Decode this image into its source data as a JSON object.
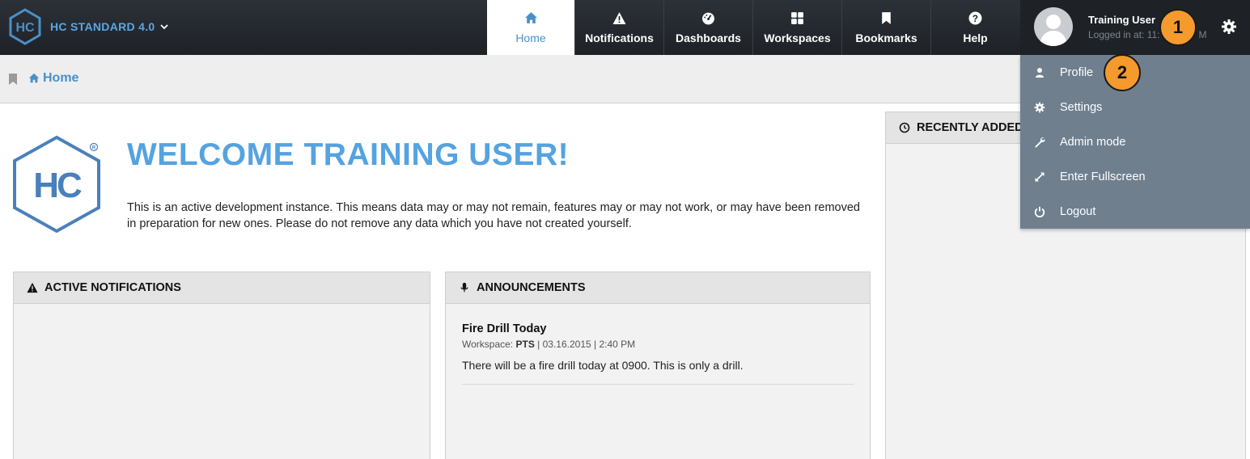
{
  "app": {
    "brand_name": "HC STANDARD 4.0"
  },
  "nav": {
    "tabs": [
      {
        "label": "Home",
        "icon": "home-icon",
        "active": true
      },
      {
        "label": "Notifications",
        "icon": "warning-icon"
      },
      {
        "label": "Dashboards",
        "icon": "dashboard-icon"
      },
      {
        "label": "Workspaces",
        "icon": "grid-icon"
      },
      {
        "label": "Bookmarks",
        "icon": "bookmark-icon"
      },
      {
        "label": "Help",
        "icon": "question-icon"
      }
    ]
  },
  "user": {
    "name": "Training User",
    "login_status": "Logged in at: 11:",
    "login_suffix": "M"
  },
  "callouts": [
    "1",
    "2"
  ],
  "breadcrumb": {
    "label": "Home"
  },
  "welcome": {
    "title": "WELCOME TRAINING USER!",
    "text": "This is an active development instance. This means data may or may not remain, features may or may not work, or may have been removed in preparation for new ones. Please do not remove any data which you have not created yourself."
  },
  "panels": {
    "notifications_title": "ACTIVE NOTIFICATIONS",
    "announcements_title": "ANNOUNCEMENTS",
    "recent_title": "RECENTLY ADDED"
  },
  "announcement": {
    "title": "Fire Drill Today",
    "workspace_label": "Workspace:",
    "workspace": "PTS",
    "date": "| 03.16.2015 | 2:40 PM",
    "body": "There will be a fire drill today at 0900. This is only a drill."
  },
  "dropdown": {
    "items": [
      {
        "label": "Profile",
        "icon": "user-icon"
      },
      {
        "label": "Settings",
        "icon": "gear-icon"
      },
      {
        "label": "Admin mode",
        "icon": "wrench-icon"
      },
      {
        "label": "Enter Fullscreen",
        "icon": "expand-icon"
      },
      {
        "label": "Logout",
        "icon": "power-icon"
      }
    ]
  },
  "colors": {
    "accent": "#55a3e0",
    "topbar": "#1e2227",
    "dropdown": "#6f7f8e",
    "callout": "#f59a2c"
  }
}
